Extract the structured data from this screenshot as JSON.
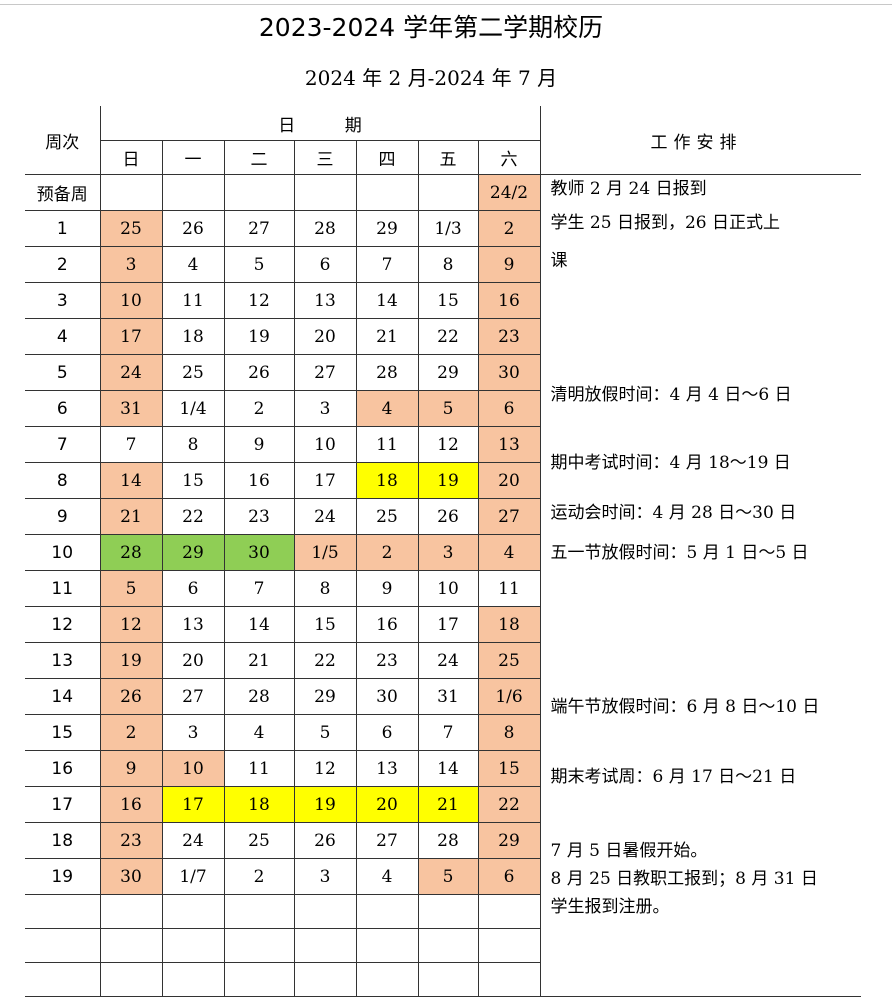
{
  "title": "2023-2024 学年第二学期校历",
  "subtitle": "2024 年 2 月-2024 年 7 月",
  "header": {
    "week": "周次",
    "date": "日 期",
    "days": [
      "日",
      "一",
      "二",
      "三",
      "四",
      "五",
      "六"
    ],
    "work": "工作安排"
  },
  "colors": {
    "orange": "#f8c4a0",
    "yellow": "#ffff00",
    "green": "#8fce55"
  },
  "rows": [
    {
      "week": "预备周",
      "days": [
        "",
        "",
        "",
        "",
        "",
        "",
        "24/2"
      ],
      "colors": [
        "",
        "",
        "",
        "",
        "",
        "",
        "o"
      ]
    },
    {
      "week": "1",
      "days": [
        "25",
        "26",
        "27",
        "28",
        "29",
        "1/3",
        "2"
      ],
      "colors": [
        "o",
        "",
        "",
        "",
        "",
        "",
        "o"
      ]
    },
    {
      "week": "2",
      "days": [
        "3",
        "4",
        "5",
        "6",
        "7",
        "8",
        "9"
      ],
      "colors": [
        "o",
        "",
        "",
        "",
        "",
        "",
        "o"
      ]
    },
    {
      "week": "3",
      "days": [
        "10",
        "11",
        "12",
        "13",
        "14",
        "15",
        "16"
      ],
      "colors": [
        "o",
        "",
        "",
        "",
        "",
        "",
        "o"
      ]
    },
    {
      "week": "4",
      "days": [
        "17",
        "18",
        "19",
        "20",
        "21",
        "22",
        "23"
      ],
      "colors": [
        "o",
        "",
        "",
        "",
        "",
        "",
        "o"
      ]
    },
    {
      "week": "5",
      "days": [
        "24",
        "25",
        "26",
        "27",
        "28",
        "29",
        "30"
      ],
      "colors": [
        "o",
        "",
        "",
        "",
        "",
        "",
        "o"
      ]
    },
    {
      "week": "6",
      "days": [
        "31",
        "1/4",
        "2",
        "3",
        "4",
        "5",
        "6"
      ],
      "colors": [
        "o",
        "",
        "",
        "",
        "o",
        "o",
        "o"
      ]
    },
    {
      "week": "7",
      "days": [
        "7",
        "8",
        "9",
        "10",
        "11",
        "12",
        "13"
      ],
      "colors": [
        "",
        "",
        "",
        "",
        "",
        "",
        "o"
      ]
    },
    {
      "week": "8",
      "days": [
        "14",
        "15",
        "16",
        "17",
        "18",
        "19",
        "20"
      ],
      "colors": [
        "o",
        "",
        "",
        "",
        "y",
        "y",
        "o"
      ]
    },
    {
      "week": "9",
      "days": [
        "21",
        "22",
        "23",
        "24",
        "25",
        "26",
        "27"
      ],
      "colors": [
        "o",
        "",
        "",
        "",
        "",
        "",
        "o"
      ]
    },
    {
      "week": "10",
      "days": [
        "28",
        "29",
        "30",
        "1/5",
        "2",
        "3",
        "4"
      ],
      "colors": [
        "g",
        "g",
        "g",
        "o",
        "o",
        "o",
        "o"
      ]
    },
    {
      "week": "11",
      "days": [
        "5",
        "6",
        "7",
        "8",
        "9",
        "10",
        "11"
      ],
      "colors": [
        "o",
        "",
        "",
        "",
        "",
        "",
        ""
      ]
    },
    {
      "week": "12",
      "days": [
        "12",
        "13",
        "14",
        "15",
        "16",
        "17",
        "18"
      ],
      "colors": [
        "o",
        "",
        "",
        "",
        "",
        "",
        "o"
      ]
    },
    {
      "week": "13",
      "days": [
        "19",
        "20",
        "21",
        "22",
        "23",
        "24",
        "25"
      ],
      "colors": [
        "o",
        "",
        "",
        "",
        "",
        "",
        "o"
      ]
    },
    {
      "week": "14",
      "days": [
        "26",
        "27",
        "28",
        "29",
        "30",
        "31",
        "1/6"
      ],
      "colors": [
        "o",
        "",
        "",
        "",
        "",
        "",
        "o"
      ]
    },
    {
      "week": "15",
      "days": [
        "2",
        "3",
        "4",
        "5",
        "6",
        "7",
        "8"
      ],
      "colors": [
        "o",
        "",
        "",
        "",
        "",
        "",
        "o"
      ]
    },
    {
      "week": "16",
      "days": [
        "9",
        "10",
        "11",
        "12",
        "13",
        "14",
        "15"
      ],
      "colors": [
        "o",
        "o",
        "",
        "",
        "",
        "",
        "o"
      ]
    },
    {
      "week": "17",
      "days": [
        "16",
        "17",
        "18",
        "19",
        "20",
        "21",
        "22"
      ],
      "colors": [
        "o",
        "y",
        "y",
        "y",
        "y",
        "y",
        "o"
      ]
    },
    {
      "week": "18",
      "days": [
        "23",
        "24",
        "25",
        "26",
        "27",
        "28",
        "29"
      ],
      "colors": [
        "o",
        "",
        "",
        "",
        "",
        "",
        "o"
      ]
    },
    {
      "week": "19",
      "days": [
        "30",
        "1/7",
        "2",
        "3",
        "4",
        "5",
        "6"
      ],
      "colors": [
        "o",
        "",
        "",
        "",
        "",
        "o",
        "o"
      ]
    }
  ],
  "work_notes": {
    "n1": "教师 2 月 24 日报到",
    "n2": "学生 25 日报到，26 日正式上",
    "n3": "课",
    "n4": "清明放假时间：4 月 4 日～6 日",
    "n5": "期中考试时间：4 月 18～19 日",
    "n6": "运动会时间：4 月 28 日～30 日",
    "n7": "五一节放假时间：5 月 1 日～5 日",
    "n8": "端午节放假时间：6 月 8 日～10 日",
    "n9": "期末考试周：6 月 17 日～21 日",
    "n10": "7 月  5 日暑假开始。",
    "n11": "8 月 25  日教职工报到；8 月 31 日",
    "n12": "学生报到注册。"
  }
}
